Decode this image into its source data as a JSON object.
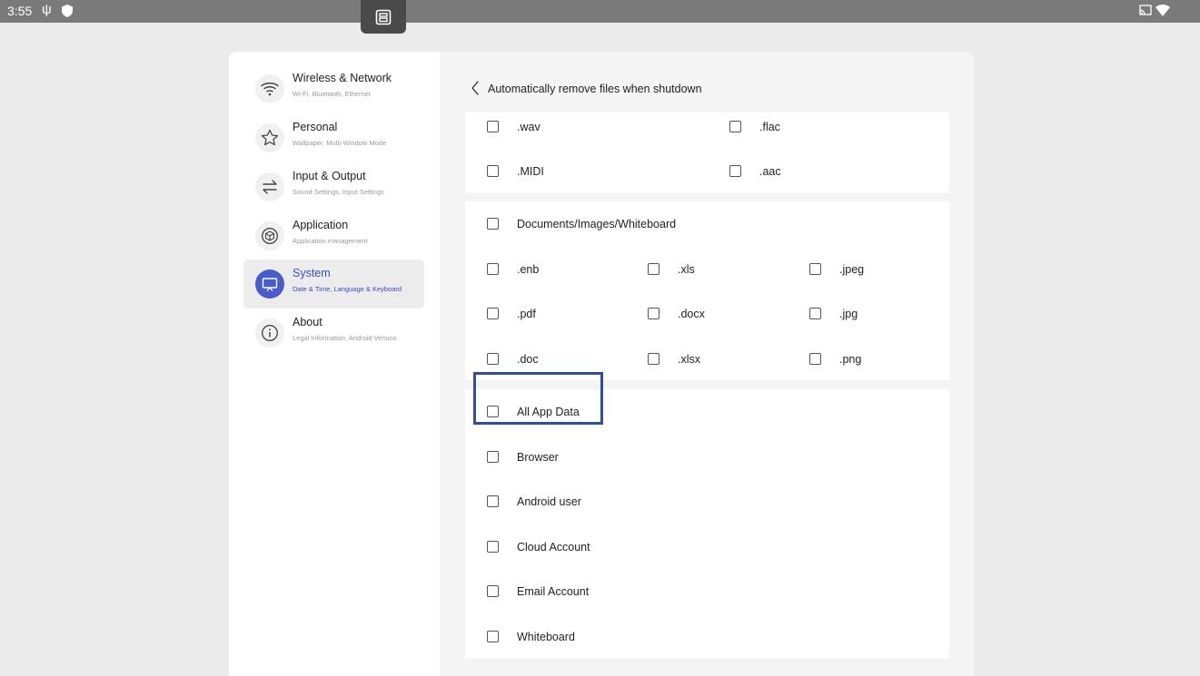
{
  "status_bar": {
    "time": "3:55",
    "icons": [
      "usb-icon",
      "shield-icon",
      "floating-window-icon",
      "cast-icon",
      "wifi-icon"
    ]
  },
  "sidebar": {
    "items": [
      {
        "title": "Wireless & Network",
        "subtitle": "Wi-Fi, Bluetooth, Ethernet",
        "icon": "wifi-icon",
        "active": false
      },
      {
        "title": "Personal",
        "subtitle": "Wallpaper, Multi-Window Mode",
        "icon": "star-icon",
        "active": false
      },
      {
        "title": "Input & Output",
        "subtitle": "Sound Settings, Input Settings",
        "icon": "swap-arrows-icon",
        "active": false
      },
      {
        "title": "Application",
        "subtitle": "Application management",
        "icon": "cube-icon",
        "active": false
      },
      {
        "title": "System",
        "subtitle": "Date & Time, Language & Keyboard",
        "icon": "monitor-icon",
        "active": true
      },
      {
        "title": "About",
        "subtitle": "Legal Information, Android Version",
        "icon": "info-icon",
        "active": false
      }
    ]
  },
  "header": {
    "title": "Automatically remove files when shutdown"
  },
  "audio": {
    "wav": ".wav",
    "flac": ".flac",
    "midi": ".MIDI",
    "aac": ".aac"
  },
  "documents": {
    "group_label": "Documents/Images/Whiteboard",
    "enb": ".enb",
    "xls": ".xls",
    "jpeg": ".jpeg",
    "pdf": ".pdf",
    "docx": ".docx",
    "jpg": ".jpg",
    "doc": ".doc",
    "xlsx": ".xlsx",
    "png": ".png"
  },
  "app_data": {
    "all": "All App Data",
    "browser": "Browser",
    "android_user": "Android user",
    "cloud_account": "Cloud Account",
    "email_account": "Email Account",
    "whiteboard": "Whiteboard"
  },
  "colors": {
    "accent": "#4a5ccc",
    "highlight_box": "#2f4f9a",
    "status_bar": "#7a7a7a"
  }
}
